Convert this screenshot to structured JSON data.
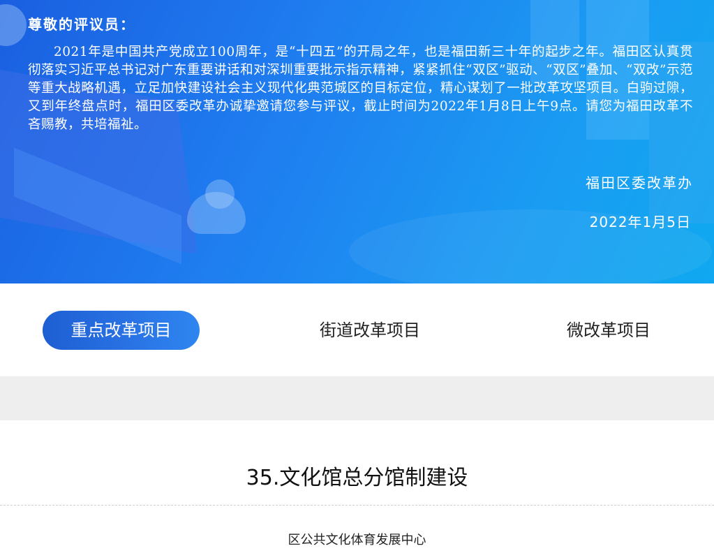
{
  "hero": {
    "salutation": "尊敬的评议员：",
    "body": "2021年是中国共产党成立100周年，是“十四五”的开局之年，也是福田新三十年的起步之年。福田区认真贯彻落实习近平总书记对广东重要讲话和对深圳重要批示指示精神，紧紧抓住“双区”驱动、“双区”叠加、“双改”示范等重大战略机遇，立足加快建设社会主义现代化典范城区的目标定位，精心谋划了一批改革攻坚项目。白驹过隙，又到年终盘点时，福田区委改革办诚挚邀请您参与评议，截止时间为2022年1月8日上午9点。请您为福田改革不吝赐教，共培福祉。",
    "signature": "福田区委改革办",
    "date": "2022年1月5日"
  },
  "tabs": [
    {
      "label": "重点改革项目",
      "active": true
    },
    {
      "label": "街道改革项目",
      "active": false
    },
    {
      "label": "微改革项目",
      "active": false
    }
  ],
  "project": {
    "title": "35.文化馆总分馆制建设",
    "org": "区公共文化体育发展中心"
  },
  "colors": {
    "hero_start": "#1a5fe0",
    "hero_end": "#0fa8f0",
    "tab_active": "#2a74e6",
    "band": "#eeeeee"
  }
}
